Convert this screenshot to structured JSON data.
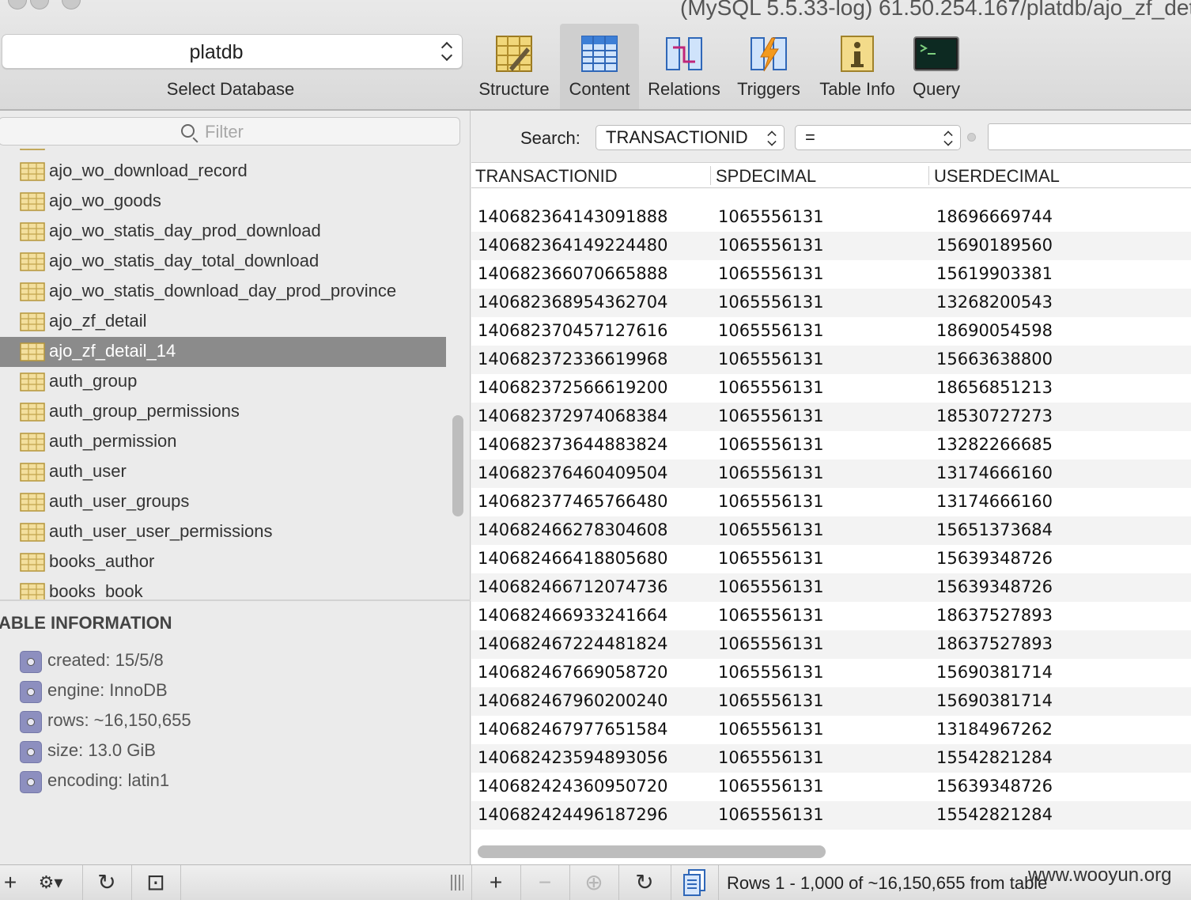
{
  "window": {
    "title": "(MySQL 5.5.33-log) 61.50.254.167/platdb/ajo_zf_det"
  },
  "database": {
    "selected": "platdb",
    "caption": "Select Database"
  },
  "toolbar": {
    "items": [
      {
        "label": "Structure",
        "icon": "structure-icon"
      },
      {
        "label": "Content",
        "icon": "content-icon",
        "active": true
      },
      {
        "label": "Relations",
        "icon": "relations-icon"
      },
      {
        "label": "Triggers",
        "icon": "triggers-icon"
      },
      {
        "label": "Table Info",
        "icon": "table-info-icon"
      },
      {
        "label": "Query",
        "icon": "query-icon"
      }
    ]
  },
  "sidebar": {
    "filter_placeholder": "Filter",
    "tables": [
      {
        "name": "ajo_wo_download_record"
      },
      {
        "name": "ajo_wo_goods"
      },
      {
        "name": "ajo_wo_statis_day_prod_download"
      },
      {
        "name": "ajo_wo_statis_day_total_download"
      },
      {
        "name": "ajo_wo_statis_download_day_prod_province"
      },
      {
        "name": "ajo_zf_detail"
      },
      {
        "name": "ajo_zf_detail_14",
        "selected": true
      },
      {
        "name": "auth_group"
      },
      {
        "name": "auth_group_permissions"
      },
      {
        "name": "auth_permission"
      },
      {
        "name": "auth_user"
      },
      {
        "name": "auth_user_groups"
      },
      {
        "name": "auth_user_user_permissions"
      },
      {
        "name": "books_author"
      },
      {
        "name": "books_book"
      }
    ],
    "info_header": "ABLE INFORMATION",
    "info": [
      "created: 15/5/8",
      "engine: InnoDB",
      "rows: ~16,150,655",
      "size: 13.0 GiB",
      "encoding: latin1"
    ]
  },
  "search": {
    "label": "Search:",
    "field": "TRANSACTIONID",
    "operator": "=",
    "value": ""
  },
  "grid": {
    "columns": [
      "TRANSACTIONID",
      "SPDECIMAL",
      "USERDECIMAL"
    ],
    "rows": [
      [
        "140682364143091888",
        "1065556131",
        "18696669744"
      ],
      [
        "140682364149224480",
        "1065556131",
        "15690189560"
      ],
      [
        "140682366070665888",
        "1065556131",
        "15619903381"
      ],
      [
        "140682368954362704",
        "1065556131",
        "13268200543"
      ],
      [
        "140682370457127616",
        "1065556131",
        "18690054598"
      ],
      [
        "140682372336619968",
        "1065556131",
        "15663638800"
      ],
      [
        "140682372566619200",
        "1065556131",
        "18656851213"
      ],
      [
        "140682372974068384",
        "1065556131",
        "18530727273"
      ],
      [
        "140682373644883824",
        "1065556131",
        "13282266685"
      ],
      [
        "140682376460409504",
        "1065556131",
        "13174666160"
      ],
      [
        "140682377465766480",
        "1065556131",
        "13174666160"
      ],
      [
        "140682466278304608",
        "1065556131",
        "15651373684"
      ],
      [
        "140682466418805680",
        "1065556131",
        "15639348726"
      ],
      [
        "140682466712074736",
        "1065556131",
        "15639348726"
      ],
      [
        "140682466933241664",
        "1065556131",
        "18637527893"
      ],
      [
        "140682467224481824",
        "1065556131",
        "18637527893"
      ],
      [
        "140682467669058720",
        "1065556131",
        "15690381714"
      ],
      [
        "140682467960200240",
        "1065556131",
        "15690381714"
      ],
      [
        "140682467977651584",
        "1065556131",
        "13184967262"
      ],
      [
        "140682423594893056",
        "1065556131",
        "15542821284"
      ],
      [
        "140682424360950720",
        "1065556131",
        "15639348726"
      ],
      [
        "140682424496187296",
        "1065556131",
        "15542821284"
      ]
    ]
  },
  "status": {
    "text": "Rows 1 - 1,000 of ~16,150,655 from table",
    "watermark": "www.wooyun.org"
  },
  "bottom_left_buttons": [
    "+",
    "⚙▾",
    "↻",
    "⊡"
  ],
  "bottom_right_buttons": [
    "+",
    "−",
    "⊕",
    "↻"
  ]
}
